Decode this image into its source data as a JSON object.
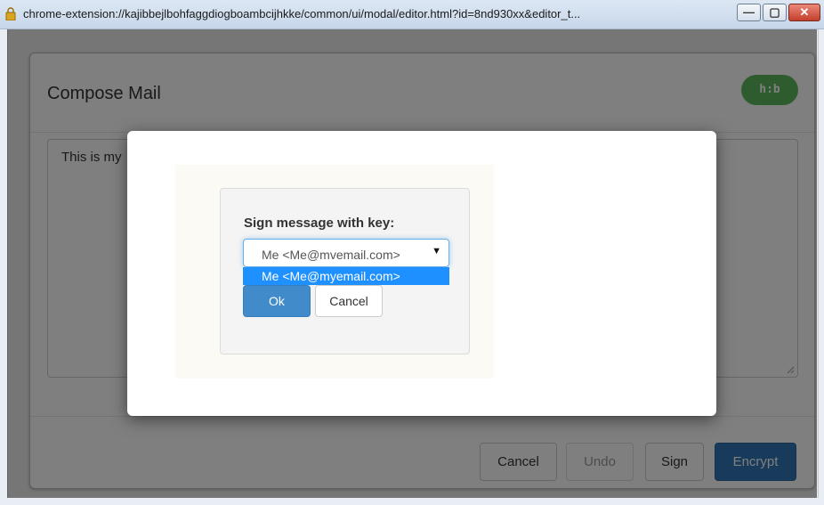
{
  "window": {
    "url": "chrome-extension://kajibbejlbohfaggdiogboambcijhkke/common/ui/modal/editor.html?id=8nd930xx&editor_t...",
    "minimize_glyph": "—",
    "maximize_glyph": "▢",
    "close_glyph": "✕"
  },
  "compose": {
    "title": "Compose Mail",
    "badge": "h:b",
    "editor_text": "This is my",
    "buttons": {
      "cancel": "Cancel",
      "undo": "Undo",
      "sign": "Sign",
      "encrypt": "Encrypt"
    }
  },
  "sign_dialog": {
    "label": "Sign message with key:",
    "select": {
      "value": "Me <Me@mvemail.com>",
      "arrow": "▼",
      "options": [
        "Me <Me@myemail.com>"
      ],
      "highlighted_index": 0
    },
    "ok": "Ok",
    "cancel": "Cancel"
  },
  "colors": {
    "badge_green": "#5cb85c",
    "primary_blue": "#428bca",
    "encrypt_blue": "#3176b6",
    "dropdown_highlight": "#1e90ff"
  }
}
